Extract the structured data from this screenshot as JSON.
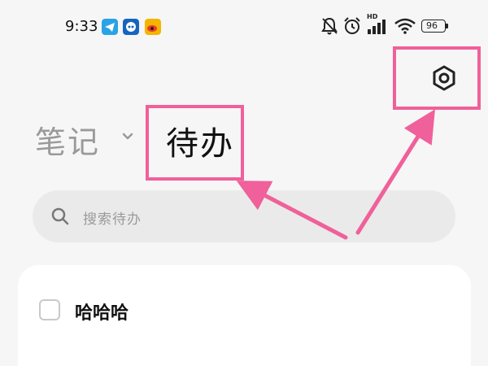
{
  "status_bar": {
    "time": "9:33",
    "battery": "96",
    "signal_label": "HD",
    "left_icons": [
      "telegram-icon",
      "robot-app-icon",
      "weibo-icon"
    ],
    "right_icons": [
      "mute-bell-icon",
      "alarm-icon",
      "signal-bars-icon",
      "wifi-icon",
      "battery-icon"
    ]
  },
  "header": {
    "tabs": [
      {
        "label": "笔记",
        "active": false
      },
      {
        "label": "待办",
        "active": true
      }
    ],
    "settings_icon": "settings-hexagon-icon"
  },
  "search": {
    "placeholder": "搜索待办"
  },
  "todos": [
    {
      "text": "哈哈哈",
      "checked": false
    }
  ],
  "annotations": {
    "highlight_color": "#f0609a"
  },
  "colors": {
    "background": "#f6f6f6",
    "inactive_tab": "#9a9a9a",
    "active_tab": "#111111",
    "search_bg": "#eaeaea",
    "card_bg": "#ffffff"
  }
}
